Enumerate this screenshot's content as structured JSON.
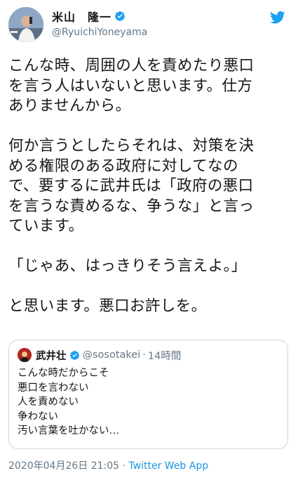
{
  "author": {
    "display_name": "米山　隆一",
    "handle": "@RyuichiYoneyama",
    "verified": true
  },
  "icons": {
    "verified": "verified-badge-icon",
    "brand": "twitter-bird-icon"
  },
  "tweet": {
    "paragraphs": [
      {
        "lines": [
          "こんな時、周囲の人を責めたり悪口",
          "を言う人はいないと思います。仕方",
          "ありませんから。"
        ]
      },
      {
        "lines": [
          "何か言うとしたらそれは、対策を決",
          "める権限のある政府に対してなの",
          "で、要するに武井氏は「政府の悪口",
          "を言うな責めるな、争うな」と言っ",
          "ています。"
        ]
      },
      {
        "lines": [
          "「じゃあ、はっきりそう言えよ。」"
        ]
      },
      {
        "lines": [
          "と思います。悪口お許しを。"
        ]
      }
    ]
  },
  "quoted_tweet": {
    "display_name": "武井壮",
    "handle": "@sosotakei",
    "separator": "·",
    "relative_time": "14時間",
    "lines": [
      "こんな時だからこそ",
      "悪口を言わない",
      "人を責めない",
      "争わない",
      "汚い言葉を吐かない…"
    ]
  },
  "footer": {
    "timestamp": "2020年04月26日 21:05",
    "separator": " · ",
    "source_app": "Twitter Web App"
  },
  "colors": {
    "text": "#14171a",
    "secondary": "#657786",
    "link": "#1b95e0",
    "verified_badge": "#1da1f2",
    "twitter_logo": "#1da1f2",
    "quote_border": "#ccd6dd"
  }
}
